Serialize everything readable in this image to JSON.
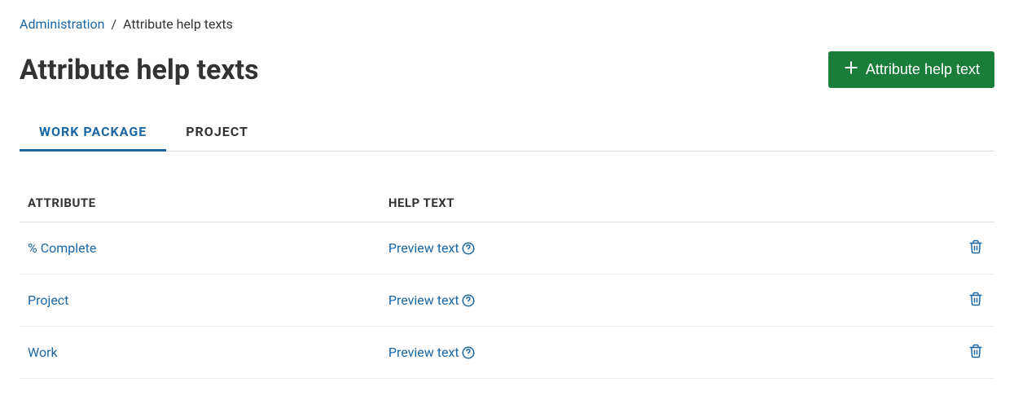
{
  "breadcrumb": {
    "parent": "Administration",
    "separator": "/",
    "current": "Attribute help texts"
  },
  "header": {
    "title": "Attribute help texts",
    "add_button_label": "Attribute help text"
  },
  "tabs": [
    {
      "label": "WORK PACKAGE",
      "active": true
    },
    {
      "label": "PROJECT",
      "active": false
    }
  ],
  "table": {
    "headers": {
      "attribute": "ATTRIBUTE",
      "help_text": "HELP TEXT"
    },
    "rows": [
      {
        "attribute": "% Complete",
        "help_text": "Preview text"
      },
      {
        "attribute": "Project",
        "help_text": "Preview text"
      },
      {
        "attribute": "Work",
        "help_text": "Preview text"
      }
    ]
  }
}
